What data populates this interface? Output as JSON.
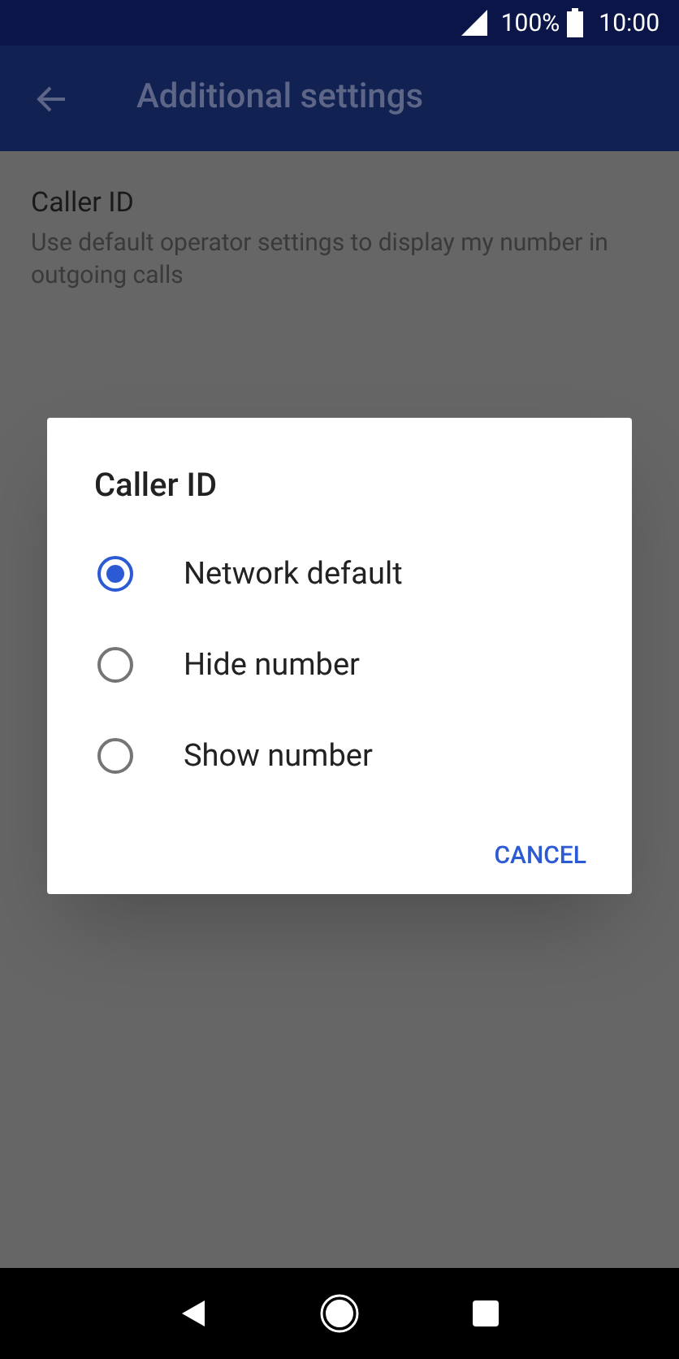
{
  "status_bar": {
    "battery": "100%",
    "time": "10:00"
  },
  "app_bar": {
    "title": "Additional settings"
  },
  "settings": [
    {
      "title": "Caller ID",
      "summary": "Use default operator settings to display my number in outgoing calls"
    }
  ],
  "dialog": {
    "title": "Caller ID",
    "options": [
      {
        "label": "Network default",
        "selected": true
      },
      {
        "label": "Hide number",
        "selected": false
      },
      {
        "label": "Show number",
        "selected": false
      }
    ],
    "button": "CANCEL"
  }
}
